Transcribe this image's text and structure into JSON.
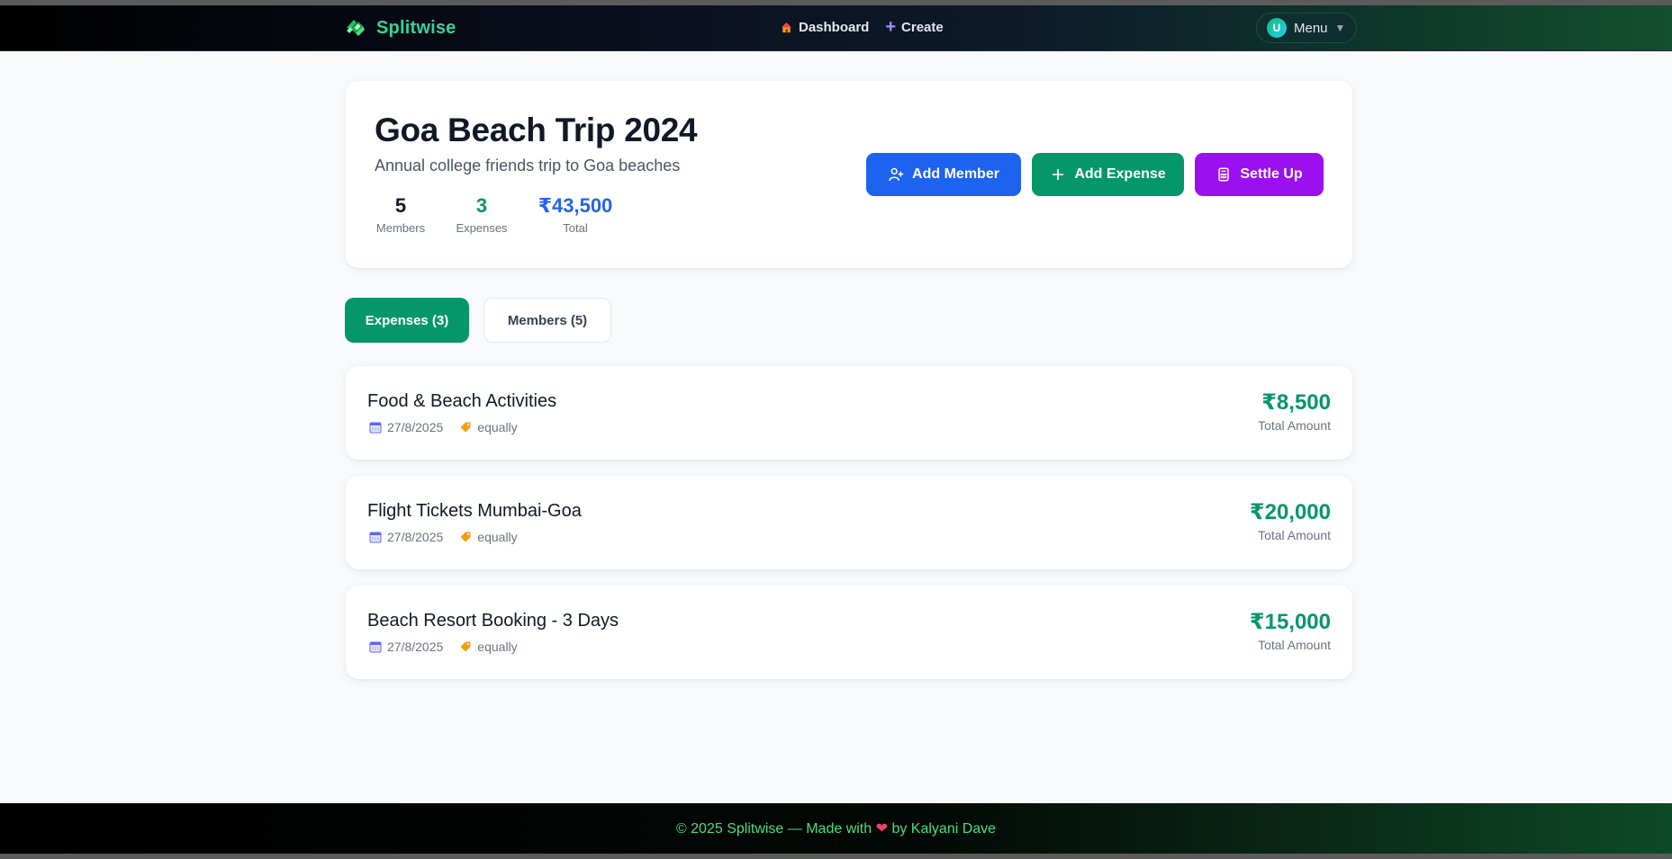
{
  "app": {
    "name": "Splitwise"
  },
  "nav": {
    "links": [
      {
        "label": "Dashboard",
        "icon": "house-icon"
      },
      {
        "label": "Create",
        "icon": "plus-icon"
      }
    ],
    "menu": {
      "label": "Menu",
      "avatar_initial": "U"
    }
  },
  "group": {
    "title": "Goa Beach Trip 2024",
    "description": "Annual college friends trip to Goa beaches",
    "stats": {
      "members": {
        "value": "5",
        "label": "Members"
      },
      "expenses": {
        "value": "3",
        "label": "Expenses"
      },
      "total": {
        "value": "₹43,500",
        "label": "Total"
      }
    }
  },
  "actions": {
    "add_member": "Add Member",
    "add_expense": "Add Expense",
    "settle_up": "Settle Up"
  },
  "tabs": {
    "expenses": "Expenses (3)",
    "members": "Members (5)"
  },
  "expenses": [
    {
      "title": "Food & Beach Activities",
      "date": "27/8/2025",
      "split": "equally",
      "amount": "₹8,500",
      "amount_label": "Total Amount"
    },
    {
      "title": "Flight Tickets Mumbai-Goa",
      "date": "27/8/2025",
      "split": "equally",
      "amount": "₹20,000",
      "amount_label": "Total Amount"
    },
    {
      "title": "Beach Resort Booking - 3 Days",
      "date": "27/8/2025",
      "split": "equally",
      "amount": "₹15,000",
      "amount_label": "Total Amount"
    }
  ],
  "footer": {
    "prefix": "© 2025 Splitwise — Made with",
    "heart": "❤",
    "suffix": "by Kalyani Dave"
  },
  "colors": {
    "brand": "#34d399",
    "primary_blue": "#1d63f0",
    "success_green": "#059669",
    "purple": "#9b10ef"
  }
}
